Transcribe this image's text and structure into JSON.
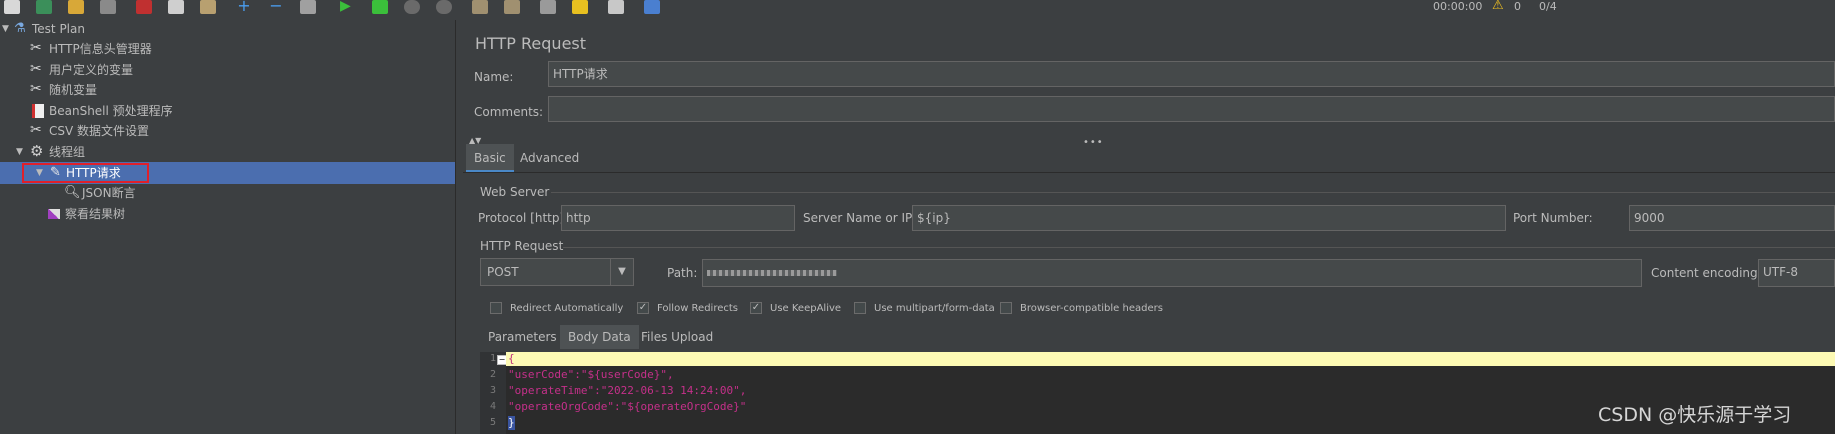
{
  "toolbar": {
    "timer": "00:00:00",
    "warnings": "0",
    "threads": "0/4"
  },
  "tree": {
    "items": [
      {
        "label": "Test Plan",
        "icon": "flask-icon"
      },
      {
        "label": "HTTP信息头管理器",
        "icon": "wrench-scissors-icon"
      },
      {
        "label": "用户定义的变量",
        "icon": "wrench-scissors-icon"
      },
      {
        "label": "随机变量",
        "icon": "wrench-scissors-icon"
      },
      {
        "label": "BeanShell 预处理程序",
        "icon": "script-icon"
      },
      {
        "label": "CSV 数据文件设置",
        "icon": "wrench-scissors-icon"
      },
      {
        "label": "线程组",
        "icon": "gear-icon"
      },
      {
        "label": "HTTP请求",
        "icon": "pipette-icon"
      },
      {
        "label": "JSON断言",
        "icon": "magnifier-icon"
      },
      {
        "label": "察看结果树",
        "icon": "chart-icon"
      }
    ]
  },
  "panel": {
    "title": "HTTP Request",
    "name_label": "Name:",
    "name_value": "HTTP请求",
    "comments_label": "Comments:",
    "comments_value": "",
    "tabs": [
      "Basic",
      "Advanced"
    ],
    "web_server": {
      "section": "Web Server",
      "protocol_label": "Protocol [http]:",
      "protocol_value": "http",
      "server_label": "Server Name or IP:",
      "server_value": "${ip}",
      "port_label": "Port Number:",
      "port_value": "9000"
    },
    "http_request": {
      "section": "HTTP Request",
      "method": "POST",
      "path_label": "Path:",
      "encoding_label": "Content encoding:",
      "encoding_value": "UTF-8"
    },
    "checkboxes": [
      {
        "label": "Redirect Automatically",
        "checked": false
      },
      {
        "label": "Follow Redirects",
        "checked": true
      },
      {
        "label": "Use KeepAlive",
        "checked": true
      },
      {
        "label": "Use multipart/form-data",
        "checked": false
      },
      {
        "label": "Browser-compatible headers",
        "checked": false
      }
    ],
    "subtabs": [
      "Parameters",
      "Body Data",
      "Files Upload"
    ]
  },
  "editor": {
    "lines": [
      "1",
      "2",
      "3",
      "4",
      "5"
    ],
    "code": [
      "{",
      "\"userCode\":\"${userCode}\",",
      "\"operateTime\":\"2022-06-13 14:24:00\",",
      "\"operateOrgCode\":\"${operateOrgCode}\"",
      "}"
    ]
  },
  "watermark": "CSDN @快乐源于学习"
}
